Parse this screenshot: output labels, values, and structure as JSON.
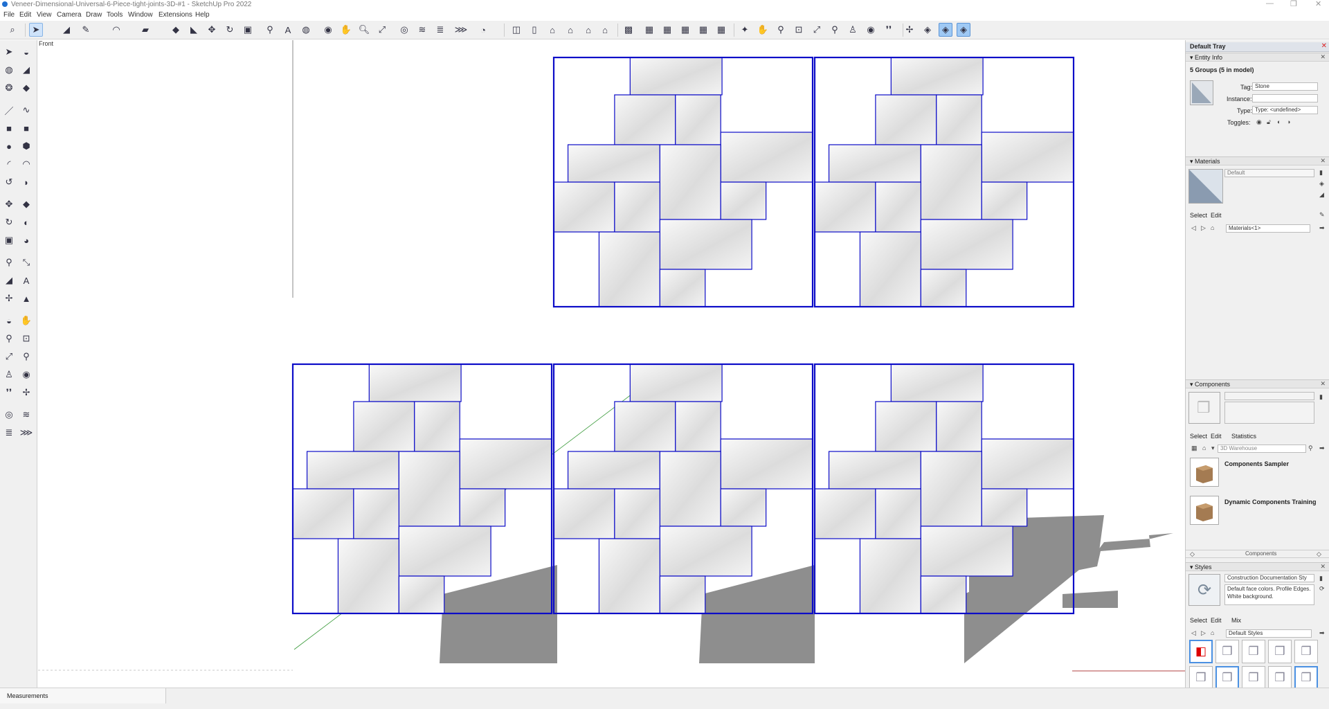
{
  "window": {
    "title": "Veneer-Dimensional-Universal-6-Piece-tight-joints-3D-#1 - SketchUp Pro 2022",
    "controls": [
      "—",
      "❐",
      "✕"
    ]
  },
  "menu": [
    "File",
    "Edit",
    "View",
    "Camera",
    "Draw",
    "Tools",
    "Window",
    "Extensions",
    "Help"
  ],
  "toolbar_icons": [
    "search-icon",
    "select-arrow-icon",
    "eraser-icon",
    "pencil-icon",
    "arc-icon",
    "paint-bucket-icon",
    "pushpull-icon",
    "follow-me-icon",
    "rotate-icon",
    "scale-icon",
    "tape-measure-icon",
    "text-icon",
    "axes-icon",
    "orbit-icon",
    "pan-icon",
    "zoom-icon",
    "zoom-extents-icon",
    "section-plane-icon",
    "section-cut-icon",
    "sandbox-icon",
    "geo-icon",
    "profile-icon",
    "iso-view-icon",
    "top-view-icon",
    "front-view-icon",
    "right-view-icon",
    "back-view-icon",
    "left-view-icon",
    "xray-icon",
    "wireframe-icon",
    "hidden-line-icon",
    "shaded-icon",
    "textured-icon",
    "monochrome-icon",
    "shadow-icon",
    "fog-icon",
    "walk-icon",
    "look-around-icon",
    "position-camera-icon",
    "solid-tools-icon",
    "outliner-icon",
    "layers-icon"
  ],
  "left_toolbar_icons": [
    "select-icon",
    "orbit-icon",
    "paint-icon",
    "eraser-icon",
    "make-component-icon",
    "tag-icon",
    "line-icon",
    "freehand-icon",
    "rectangle-icon",
    "rotated-rect-icon",
    "circle-icon",
    "polygon-icon",
    "arc-icon",
    "pie-icon",
    "two-point-arc-icon",
    "three-point-arc-icon",
    "move-icon",
    "pushpull-icon",
    "rotate-icon",
    "follow-me-icon",
    "scale-icon",
    "offset-icon",
    "tape-icon",
    "dimension-icon",
    "protractor-icon",
    "text-icon",
    "axes-icon",
    "3d-text-icon",
    "orbit2-icon",
    "pan-icon",
    "zoom-icon",
    "zoom-window-icon",
    "zoom-extents-icon",
    "previous-view-icon",
    "position-camera-icon",
    "look-around-icon",
    "walk-icon",
    "section-icon",
    "sandbox-icon",
    "sandbox2-icon",
    "sandbox3-icon",
    "sandbox4-icon"
  ],
  "scene": {
    "view_label": "Front",
    "tile_stroke": "#0c0cc8",
    "shadow_color": "#8e8e8e"
  },
  "tray": {
    "title": "Default Tray",
    "entity_info": {
      "header": "Entity Info",
      "summary": "5 Groups (5 in model)",
      "tag_label": "Tag:",
      "tag_value": "Stone",
      "instance_label": "Instance:",
      "type_label": "Type:",
      "type_value": "Type: <undefined>",
      "toggles_label": "Toggles:"
    },
    "materials": {
      "header": "Materials",
      "current": "Default",
      "tabs": [
        "Select",
        "Edit"
      ],
      "library": "Materials<1>"
    },
    "components": {
      "header": "Components",
      "tabs": [
        "Select",
        "Edit",
        "Statistics"
      ],
      "search_placeholder": "3D Warehouse",
      "items": [
        "Components Sampler",
        "Dynamic Components Training"
      ],
      "footer": "Components"
    },
    "styles": {
      "header": "Styles",
      "name": "Construction Documentation Sty",
      "description": "Default face colors. Profile Edges. White background.",
      "tabs": [
        "Select",
        "Edit",
        "Mix"
      ],
      "library": "Default Styles"
    }
  },
  "status": {
    "measurements_label": "Measurements"
  }
}
